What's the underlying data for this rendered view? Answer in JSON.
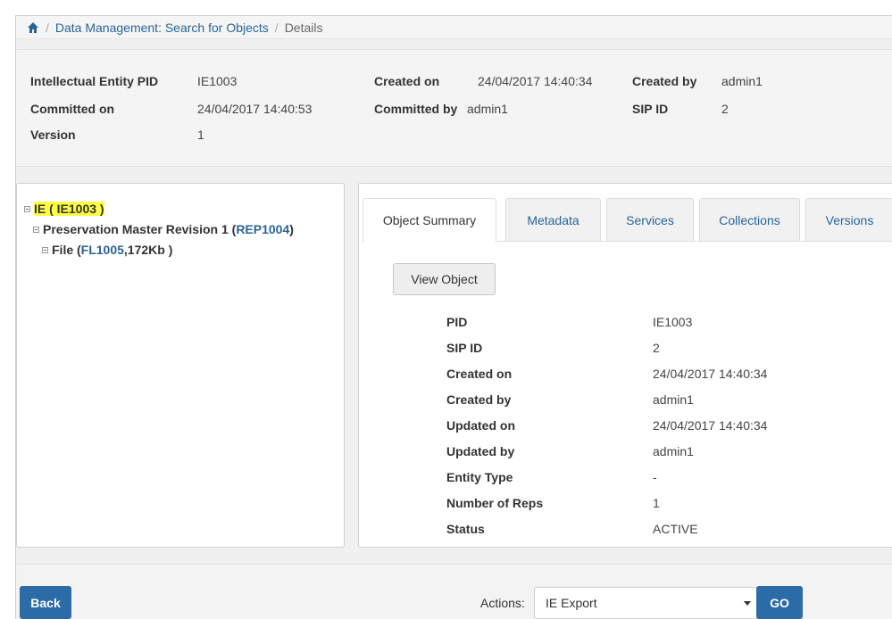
{
  "breadcrumb": {
    "home_icon": "home-icon",
    "separator": "/",
    "link": "Data Management: Search for Objects",
    "current": "Details"
  },
  "header": {
    "ie_pid_label": "Intellectual Entity PID",
    "ie_pid_value": "IE1003",
    "created_on_label": "Created on",
    "created_on_value": "24/04/2017 14:40:34",
    "created_by_label": "Created by",
    "created_by_value": "admin1",
    "committed_on_label": "Committed on",
    "committed_on_value": "24/04/2017 14:40:53",
    "committed_by_label": "Committed by",
    "committed_by_value": "admin1",
    "sip_id_label": "SIP ID",
    "sip_id_value": "2",
    "version_label": "Version",
    "version_value": "1"
  },
  "tree": {
    "ie": {
      "prefix": "IE ( ",
      "id": "IE1003",
      "suffix": " )"
    },
    "rep": {
      "prefix": "Preservation Master Revision 1 ( ",
      "id": "REP1004",
      "suffix": " )"
    },
    "file": {
      "prefix": "File ( ",
      "id": "FL1005",
      "suffix": " ,172Kb )"
    }
  },
  "tabs": [
    "Object Summary",
    "Metadata",
    "Services",
    "Collections",
    "Versions"
  ],
  "view_object_label": "View Object",
  "details": [
    {
      "label": "PID",
      "value": "IE1003"
    },
    {
      "label": "SIP ID",
      "value": "2"
    },
    {
      "label": "Created on",
      "value": "24/04/2017 14:40:34"
    },
    {
      "label": "Created by",
      "value": "admin1"
    },
    {
      "label": "Updated on",
      "value": "24/04/2017 14:40:34"
    },
    {
      "label": "Updated by",
      "value": "admin1"
    },
    {
      "label": "Entity Type",
      "value": "-"
    },
    {
      "label": "Number of Reps",
      "value": "1"
    },
    {
      "label": "Status",
      "value": "ACTIVE"
    }
  ],
  "footer": {
    "back_label": "Back",
    "actions_label": "Actions:",
    "actions_selected": "IE Export",
    "go_label": "GO"
  },
  "colors": {
    "primary_button": "#2b6ca8",
    "link": "#2a6496",
    "highlight": "#ffff44"
  }
}
